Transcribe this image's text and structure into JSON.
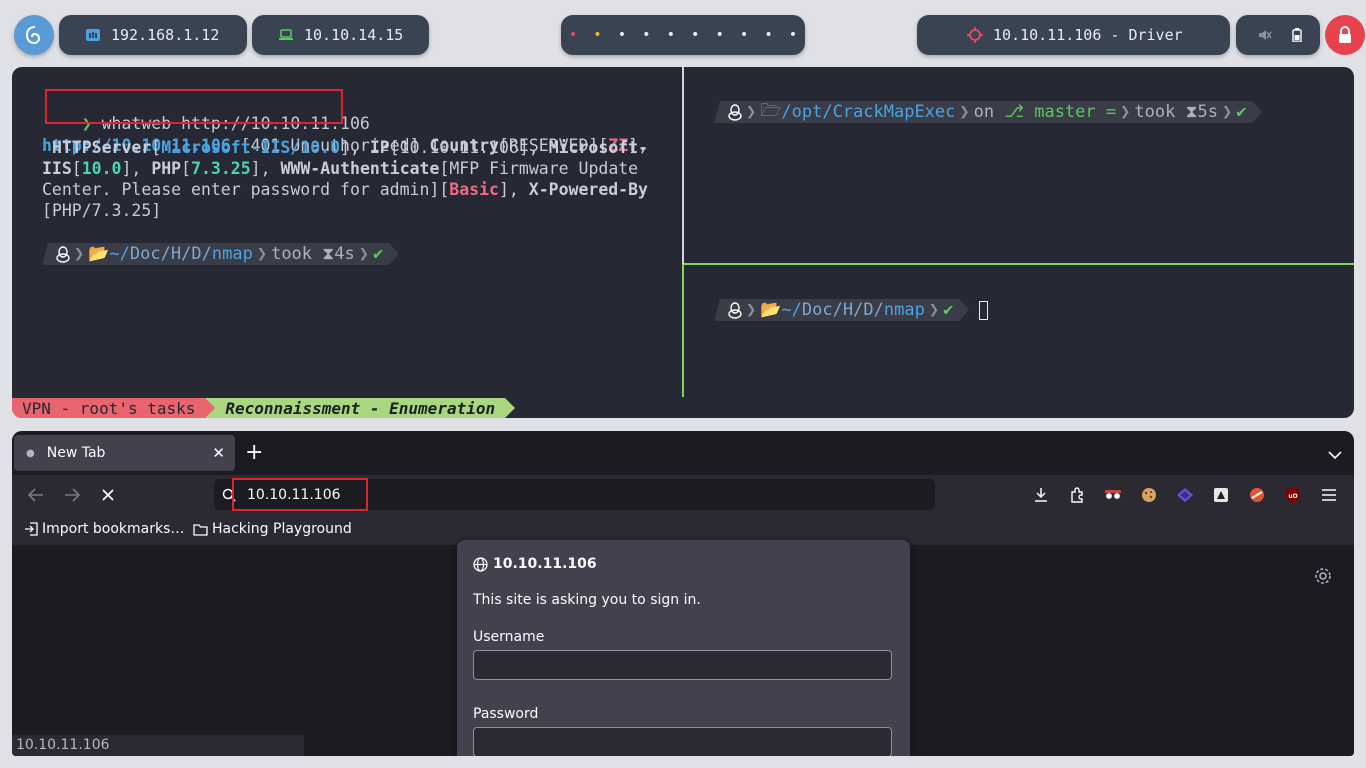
{
  "topbar": {
    "lan_ip": "192.168.1.12",
    "vpn_ip": "10.10.14.15",
    "target": "10.10.11.106 - Driver",
    "workspaces": [
      "•",
      "•",
      "•",
      "•",
      "•",
      "•",
      "•",
      "•",
      "•",
      "•"
    ]
  },
  "terminal": {
    "command_prompt": "❯",
    "command": "whatweb http://10.10.11.106",
    "output": {
      "url": "http://10.10.11.106",
      "status": " [401 Unauthorized] ",
      "country_key": "Country",
      "country_val1": "RESERVED",
      "country_val2": "ZZ",
      "httpserver_key": "HTTPServer",
      "httpserver_val": "Microsoft-IIS/10.0",
      "ip_key": "IP",
      "ip_val": "10.10.11.106",
      "ms_key_a": "Microsoft-",
      "ms_key_b": "IIS",
      "ms_val": "10.0",
      "php_key": "PHP",
      "php_val": "7.3.25",
      "auth_key": "WWW-Authenticate",
      "auth_val1": "MFP Firmware Update",
      "auth_val2": "Center. Please enter password for admin",
      "auth_val3": "Basic",
      "xpb_key": "X-Powered-By",
      "xpb_val": "PHP/7.3.25"
    },
    "prompt_left": {
      "path_home": "~/",
      "path_doc": "Doc",
      "path_h": "H",
      "path_d": "D",
      "path_nmap": "nmap",
      "took": "took",
      "duration": "4s",
      "ok": "✔"
    },
    "prompt_right_top": {
      "path_root": "/",
      "path_opt": "opt",
      "path_cme": "CrackMapExec",
      "on": "on",
      "branch": "master =",
      "took": "took",
      "duration": "5s",
      "ok": "✔"
    },
    "prompt_right_bottom": {
      "path_home": "~/",
      "path_doc": "Doc",
      "path_h": "H",
      "path_d": "D",
      "path_nmap": "nmap",
      "ok": "✔"
    },
    "status_left": "VPN - root's tasks",
    "status_right": "Reconnaissment - Enumeration"
  },
  "browser": {
    "tab_title": "New Tab",
    "url": "10.10.11.106",
    "bookmarks": [
      "Import bookmarks…",
      "Hacking Playground"
    ],
    "status_url": "10.10.11.106",
    "dialog": {
      "host": "10.10.11.106",
      "message": "This site is asking you to sign in.",
      "username_label": "Username",
      "password_label": "Password",
      "username_value": "",
      "password_value": ""
    }
  }
}
